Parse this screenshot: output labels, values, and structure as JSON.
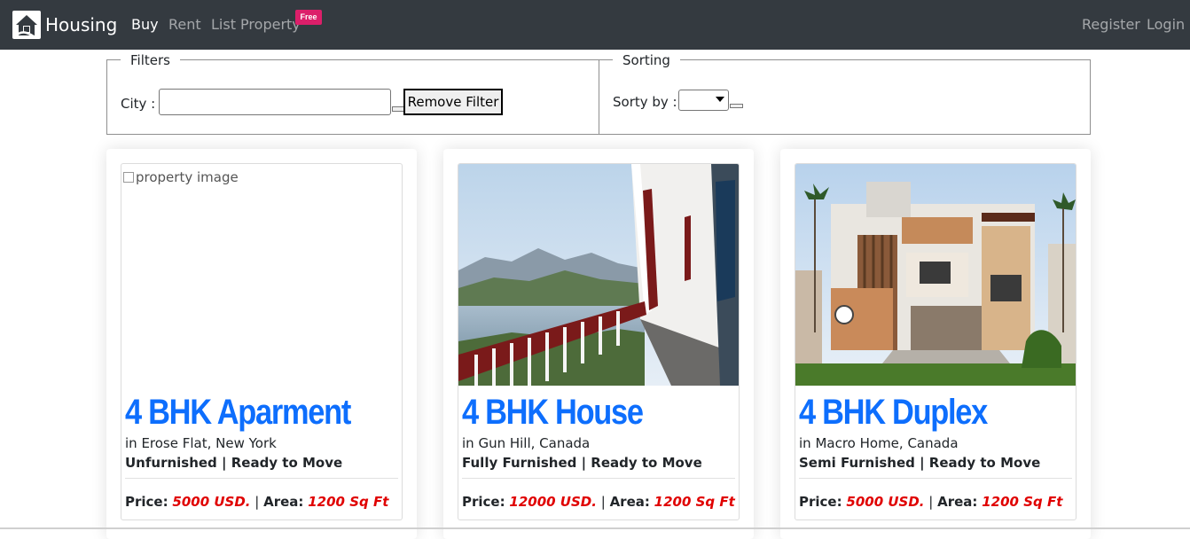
{
  "navbar": {
    "brand": "Housing",
    "brand_icon": "house-icon",
    "links": [
      {
        "label": "Buy",
        "active": true
      },
      {
        "label": "Rent",
        "active": false
      },
      {
        "label": "List Property",
        "active": false
      }
    ],
    "badge": "Free",
    "right_links": [
      "Register",
      "Login"
    ]
  },
  "filters": {
    "legend": "Filters",
    "city_label": "City :",
    "city_value": "",
    "remove_button": "Remove Filter"
  },
  "sorting": {
    "legend": "Sorting",
    "sort_label": "Sorty by :",
    "sort_selected": ""
  },
  "properties": [
    {
      "title": "4 BHK Aparment",
      "location": "in Erose Flat, New York",
      "furnishing": "Unfurnished | Ready to Move",
      "price_label": "Price:",
      "price": "5000 USD.",
      "area_label": "Area:",
      "area": "1200 Sq Ft",
      "image_alt": "property image",
      "image_state": "broken"
    },
    {
      "title": "4 BHK House",
      "location": "in Gun Hill, Canada",
      "furnishing": "Fully Furnished | Ready to Move",
      "price_label": "Price:",
      "price": "12000 USD.",
      "area_label": "Area:",
      "area": "1200 Sq Ft",
      "image_alt": "property image",
      "image_state": "photo"
    },
    {
      "title": "4 BHK Duplex",
      "location": "in Macro Home, Canada",
      "furnishing": "Semi Furnished | Ready to Move",
      "price_label": "Price:",
      "price": "5000 USD.",
      "area_label": "Area:",
      "area": "1200 Sq Ft",
      "image_alt": "property image",
      "image_state": "photo"
    }
  ],
  "colors": {
    "navbar_bg": "#343a40",
    "title_blue": "#0d6efd",
    "price_red": "#e00000",
    "badge_pink": "#dc1f6a"
  }
}
